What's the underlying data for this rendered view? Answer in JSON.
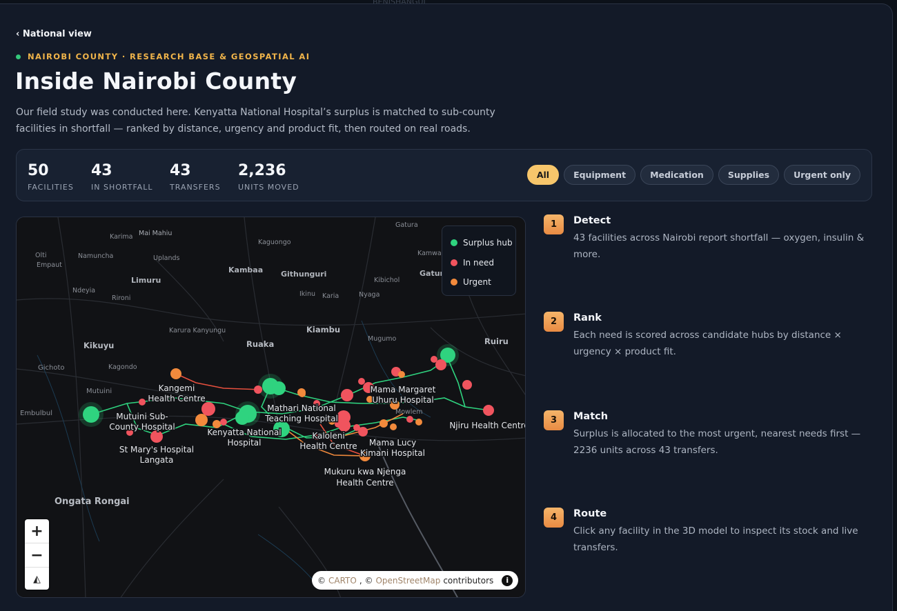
{
  "nav": {
    "back_label": "‹ National view"
  },
  "eyebrow": "NAIROBI COUNTY · RESEARCH BASE & GEOSPATIAL AI",
  "title": "Inside Nairobi County",
  "lede": "Our field study was conducted here. Kenyatta National Hospital’s surplus is matched to sub-county facilities in shortfall — ranked by distance, urgency and product fit, then routed on real roads.",
  "stats": [
    {
      "value": "50",
      "label": "FACILITIES"
    },
    {
      "value": "43",
      "label": "IN SHORTFALL"
    },
    {
      "value": "43",
      "label": "TRANSFERS"
    },
    {
      "value": "2,236",
      "label": "UNITS MOVED"
    }
  ],
  "filters": {
    "selected": "All",
    "options": [
      "All",
      "Equipment",
      "Medication",
      "Supplies",
      "Urgent only"
    ]
  },
  "legend": {
    "items": [
      {
        "label": "Surplus hub",
        "color": "#2fd37f"
      },
      {
        "label": "In need",
        "color": "#f0545e"
      },
      {
        "label": "Urgent",
        "color": "#f28a3c"
      }
    ]
  },
  "map": {
    "place_labels_small": [
      "Gatura",
      "Karima",
      "Mai Mahiu",
      "Kaguongo",
      "Olti",
      "Empaut",
      "Namuncha",
      "Uplands",
      "Kambaa",
      "Githunguri",
      "Gatun",
      "Kamwa",
      "Limuru",
      "Kibichol",
      "Ndeyia",
      "Rironi",
      "Ikinu",
      "Karia",
      "Nyaga",
      "Karura Kanyungu",
      "Kiambu",
      "Mugumo",
      "Ruiru",
      "Kikuyu",
      "Ruaka",
      "Gichoto",
      "Kagondo",
      "Mutuini",
      "Embulbul",
      "Mowlem",
      "Ongata Rongai"
    ],
    "facility_labels": [
      {
        "line1": "Kangemi",
        "line2": "Health Centre"
      },
      {
        "line1": "Mutuini Sub-",
        "line2": "County Hospital"
      },
      {
        "line1": "St Mary's Hospital",
        "line2": "Langata"
      },
      {
        "line1": "Kenyatta National",
        "line2": "Hospital"
      },
      {
        "line1": "Mathari National",
        "line2": "Teaching Hospital"
      },
      {
        "line1": "Mama Margaret",
        "line2": "Uhuru Hospital"
      },
      {
        "line1": "Kaloleni",
        "line2": "Health Centre"
      },
      {
        "line1": "Mama Lucy",
        "line2": "Kimani Hospital"
      },
      {
        "line1": "Mukuru kwa Njenga",
        "line2": "Health Centre"
      },
      {
        "line1": "Njiru Health Centre",
        "line2": ""
      }
    ],
    "zoom_in": "+",
    "zoom_out": "−",
    "compass": "◭",
    "attribution": {
      "prefix": "© ",
      "carto": "CARTO",
      "sep": ", © ",
      "osm": "OpenStreetMap",
      "suffix": " contributors",
      "info": "i"
    }
  },
  "steps": [
    {
      "num": "1",
      "title": "Detect",
      "body": "43 facilities across Nairobi report shortfall — oxygen, insulin & more."
    },
    {
      "num": "2",
      "title": "Rank",
      "body": "Each need is scored across candidate hubs by distance × urgency × product fit."
    },
    {
      "num": "3",
      "title": "Match",
      "body": "Surplus is allocated to the most urgent, nearest needs first — 2236 units across 43 transfers."
    },
    {
      "num": "4",
      "title": "Route",
      "body": "Click any facility in the 3D model to inspect its stock and live transfers."
    }
  ],
  "bg_labels": [
    "BENISHANGUL"
  ]
}
